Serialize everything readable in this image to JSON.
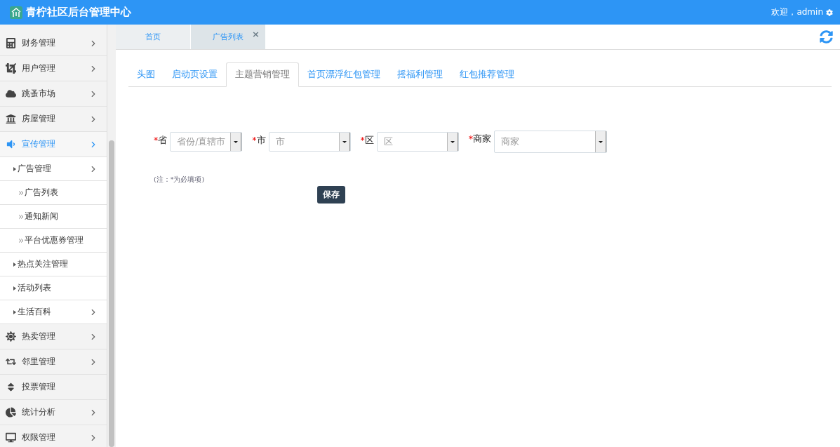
{
  "header": {
    "title": "青柠社区后台管理中心",
    "welcome": "欢迎，admin"
  },
  "sidebar": {
    "items": [
      {
        "label": "财务管理",
        "kind": "group",
        "expanded": false
      },
      {
        "label": "用户管理",
        "kind": "group",
        "expanded": false
      },
      {
        "label": "跳蚤市场",
        "kind": "group",
        "expanded": false
      },
      {
        "label": "房屋管理",
        "kind": "group",
        "expanded": false
      },
      {
        "label": "宣传管理",
        "kind": "group",
        "expanded": true,
        "children": [
          {
            "label": "广告管理",
            "kind": "group",
            "children": [
              {
                "label": "广告列表"
              },
              {
                "label": "通知新闻"
              },
              {
                "label": "平台优惠券管理"
              }
            ]
          },
          {
            "label": "热点关注管理",
            "kind": "leaf"
          },
          {
            "label": "活动列表",
            "kind": "leaf"
          },
          {
            "label": "生活百科",
            "kind": "group"
          }
        ]
      },
      {
        "label": "热卖管理",
        "kind": "group",
        "expanded": false
      },
      {
        "label": "邻里管理",
        "kind": "group",
        "expanded": false
      },
      {
        "label": "投票管理",
        "kind": "leaf",
        "expanded": false
      },
      {
        "label": "统计分析",
        "kind": "group",
        "expanded": false
      },
      {
        "label": "权限管理",
        "kind": "group",
        "expanded": false
      }
    ]
  },
  "page_tabs": [
    {
      "label": "首页",
      "selected": false,
      "closable": false
    },
    {
      "label": "广告列表",
      "selected": true,
      "closable": true
    }
  ],
  "close_symbol": "×",
  "sub_tabs": [
    {
      "label": "头图",
      "selected": false
    },
    {
      "label": "启动页设置",
      "selected": false
    },
    {
      "label": "主题营销管理",
      "selected": true
    },
    {
      "label": "首页漂浮红包管理",
      "selected": false
    },
    {
      "label": "摇福利管理",
      "selected": false
    },
    {
      "label": "红包推荐管理",
      "selected": false
    }
  ],
  "form": {
    "fields": [
      {
        "label": "省",
        "placeholder": "省份/直辖市"
      },
      {
        "label": "市",
        "placeholder": "市"
      },
      {
        "label": "区",
        "placeholder": "区"
      },
      {
        "label": "商家",
        "placeholder": "商家"
      }
    ],
    "required_mark": "*",
    "note": "(注：*为必填项)",
    "save": "保存"
  }
}
